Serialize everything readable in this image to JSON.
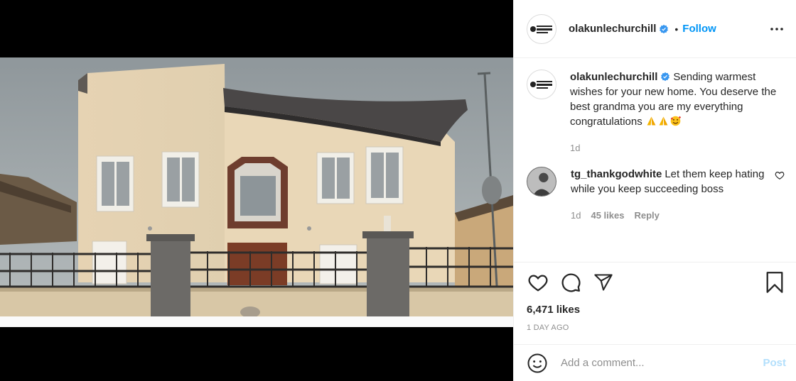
{
  "post": {
    "author": {
      "username": "olakunlechurchill",
      "verified": true
    },
    "header": {
      "dot": "•",
      "follow_label": "Follow",
      "more_icon": "more-horizontal-icon"
    },
    "caption": {
      "username": "olakunlechurchill",
      "text": "Sending warmest wishes for your new home. You deserve the best grandma you are my everything congratulations",
      "emojis": [
        "folded-hands-emoji",
        "folded-hands-emoji",
        "smiling-face-with-hearts-emoji"
      ],
      "time": "1d"
    },
    "comments": [
      {
        "username": "tg_thankgodwhite",
        "text": "Let them keep hating while you keep succeeding boss",
        "time": "1d",
        "likes": "45 likes",
        "reply_label": "Reply"
      }
    ],
    "actions": {
      "icons": [
        "heart-icon",
        "comment-icon",
        "share-icon",
        "bookmark-icon"
      ]
    },
    "likes": "6,471 likes",
    "posted": "1 DAY AGO",
    "add_comment": {
      "placeholder": "Add a comment...",
      "post_label": "Post"
    },
    "colors": {
      "link": "#0095f6",
      "post_disabled": "#b2dffc",
      "muted": "#8e8e8e",
      "text": "#262626",
      "border": "#efefef"
    }
  }
}
